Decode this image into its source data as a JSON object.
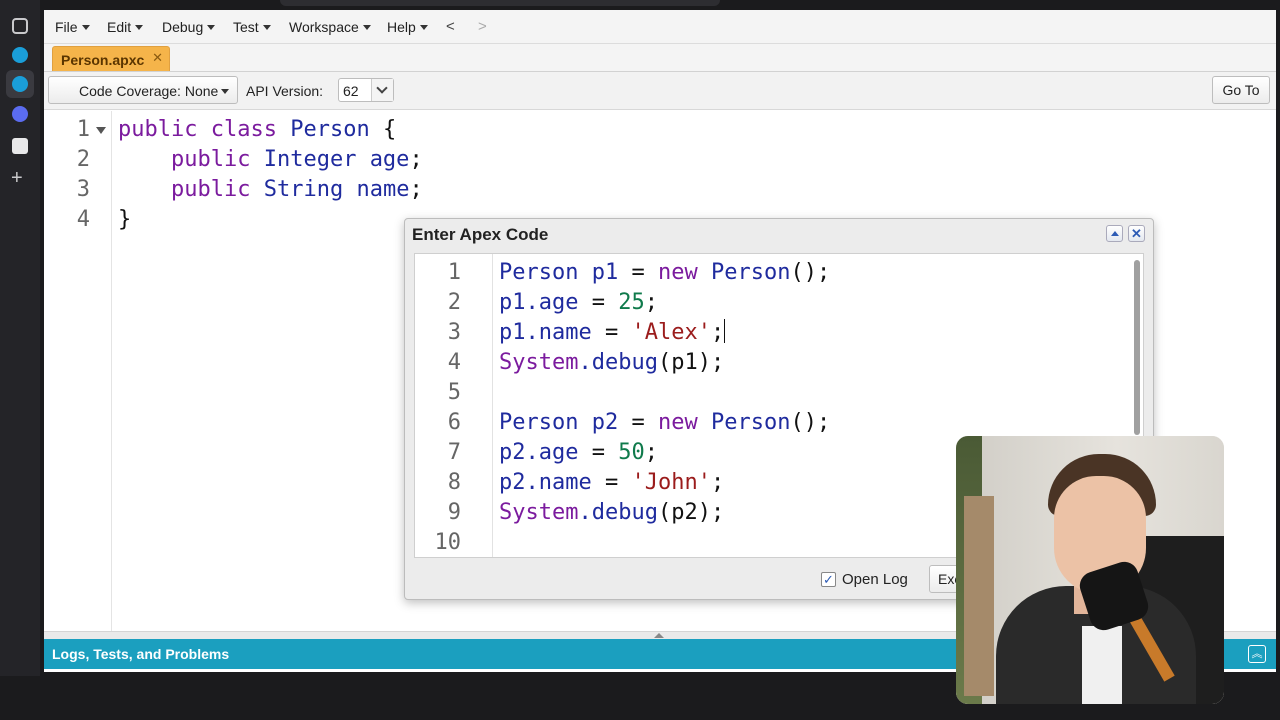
{
  "menubar": {
    "items": [
      {
        "label": "File"
      },
      {
        "label": "Edit"
      },
      {
        "label": "Debug"
      },
      {
        "label": "Test"
      },
      {
        "label": "Workspace"
      },
      {
        "label": "Help"
      }
    ],
    "back": "<",
    "forward": ">"
  },
  "tabs": [
    {
      "label": "Person.apxc",
      "close": "✕",
      "active": true
    }
  ],
  "toolbar": {
    "coverage_label": "Code Coverage: None",
    "api_label": "API Version:",
    "api_value": "62",
    "goto_label": "Go To"
  },
  "editor": {
    "lines": [
      {
        "n": "1",
        "text": "public class Person {"
      },
      {
        "n": "2",
        "text": "    public Integer age;"
      },
      {
        "n": "3",
        "text": "    public String name;"
      },
      {
        "n": "4",
        "text": "}"
      }
    ]
  },
  "dialog": {
    "title": "Enter Apex Code",
    "lines": [
      {
        "n": "1",
        "text": "Person p1 = new Person();"
      },
      {
        "n": "2",
        "text": "p1.age = 25;"
      },
      {
        "n": "3",
        "text": "p1.name = 'Alex';"
      },
      {
        "n": "4",
        "text": "System.debug(p1);"
      },
      {
        "n": "5",
        "text": ""
      },
      {
        "n": "6",
        "text": "Person p2 = new Person();"
      },
      {
        "n": "7",
        "text": "p2.age = 50;"
      },
      {
        "n": "8",
        "text": "p2.name = 'John';"
      },
      {
        "n": "9",
        "text": "System.debug(p2);"
      },
      {
        "n": "10",
        "text": ""
      }
    ],
    "open_log_label": "Open Log",
    "open_log_checked": true,
    "execute_label": "Execute"
  },
  "bottom_panel": {
    "title": "Logs, Tests, and Problems"
  },
  "colors": {
    "tab_active": "#f5b44a",
    "bottom_bar": "#1b9fbf",
    "keyword": "#7b1b9e",
    "type": "#1f2b9e",
    "number": "#0f7a4b",
    "string": "#9b1c1c"
  }
}
